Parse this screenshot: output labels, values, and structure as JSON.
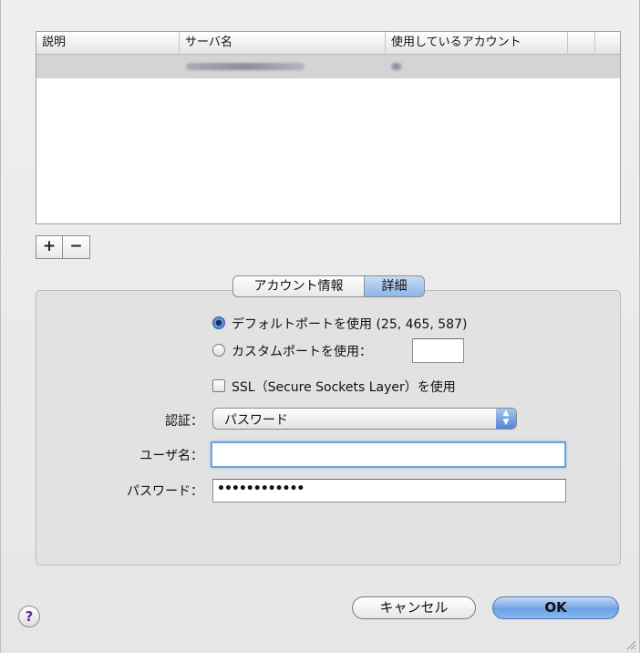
{
  "table": {
    "columns": [
      "説明",
      "サーバ名",
      "使用しているアカウント"
    ]
  },
  "list_buttons": {
    "add": "+",
    "remove": "−"
  },
  "tabs": [
    {
      "label": "アカウント情報",
      "selected": false
    },
    {
      "label": "詳細",
      "selected": true
    }
  ],
  "port": {
    "default_label": "デフォルトポートを使用 (25, 465, 587)",
    "custom_label": "カスタムポートを使用：",
    "custom_value": "",
    "selected": "default"
  },
  "ssl": {
    "label": "SSL（Secure Sockets Layer）を使用",
    "checked": false
  },
  "auth": {
    "label": "認証：",
    "value": "パスワード"
  },
  "username": {
    "label": "ユーザ名：",
    "value": ""
  },
  "password": {
    "label": "パスワード：",
    "value": "••••••••••••"
  },
  "footer": {
    "help": "?",
    "cancel": "キャンセル",
    "ok": "OK"
  },
  "colors": {
    "accent": "#6ea2e6",
    "selection": "#d4d4d4"
  },
  "icons": {
    "help": "question-mark-icon",
    "popup": "updown-arrows-icon",
    "resize": "resize-grip-icon"
  }
}
